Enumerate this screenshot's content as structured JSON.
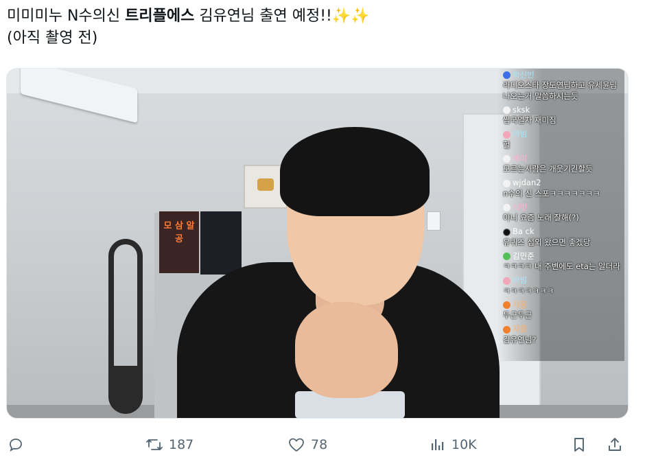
{
  "tweet": {
    "text_part1": "미미미누 N수의신 ",
    "text_bold": "트리플에스",
    "text_part2": " 김유연님 출연 예정!!",
    "sparkles": "✨✨",
    "text_line2": "(아직 촬영 전)"
  },
  "media": {
    "poster_text": "모 삼 알 공"
  },
  "chat": [
    {
      "user": "박신빈",
      "badge": "b-blue",
      "name_color": "un-cyan",
      "message": "라디오스타 장도연님하고 유세윤님 나오는거 말씀하시는듯"
    },
    {
      "user": "sksk",
      "badge": "b-white",
      "name_color": "un-white",
      "message": "썹국열차 재미짐"
    },
    {
      "user": "라빔",
      "badge": "b-pink",
      "name_color": "un-cyan",
      "message": "헐"
    },
    {
      "user": "바미",
      "badge": "b-white",
      "name_color": "un-pink",
      "message": "모르는사람은 개웃기긴할듯"
    },
    {
      "user": "wjdan2",
      "badge": "b-white",
      "name_color": "un-white",
      "message": "n수의 신 스포ㅋㅋㅋㅋㅋㅋㅋ"
    },
    {
      "user": "캐럿",
      "badge": "b-white",
      "name_color": "un-pink",
      "message": "아니 요즘 노래 잘해(?)"
    },
    {
      "user": "Ba ck",
      "badge": "b-black",
      "name_color": "un-white",
      "message": "유퀴즈 섭외 왔으면 좋겠당"
    },
    {
      "user": "김민준",
      "badge": "b-green",
      "name_color": "un-white",
      "message": "ㅋㅋㅋㅋ 내 주변에도 eta는 알더라"
    },
    {
      "user": "라빔",
      "badge": "b-pink",
      "name_color": "un-cyan",
      "message": "ㅋㅋㅋㅋㅋㅋㅋ"
    },
    {
      "user": "자몽",
      "badge": "b-orange",
      "name_color": "un-orange",
      "message": "두근두근"
    },
    {
      "user": "자몽",
      "badge": "b-orange",
      "name_color": "un-orange",
      "message": "김유연님?"
    }
  ],
  "actions": {
    "reply_icon": "reply-icon",
    "retweet_count": "187",
    "like_count": "78",
    "views_count": "10K",
    "bookmark_icon": "bookmark-icon",
    "share_icon": "share-icon"
  },
  "colors": {
    "icon_gray": "#536471",
    "text": "#0f1419"
  }
}
